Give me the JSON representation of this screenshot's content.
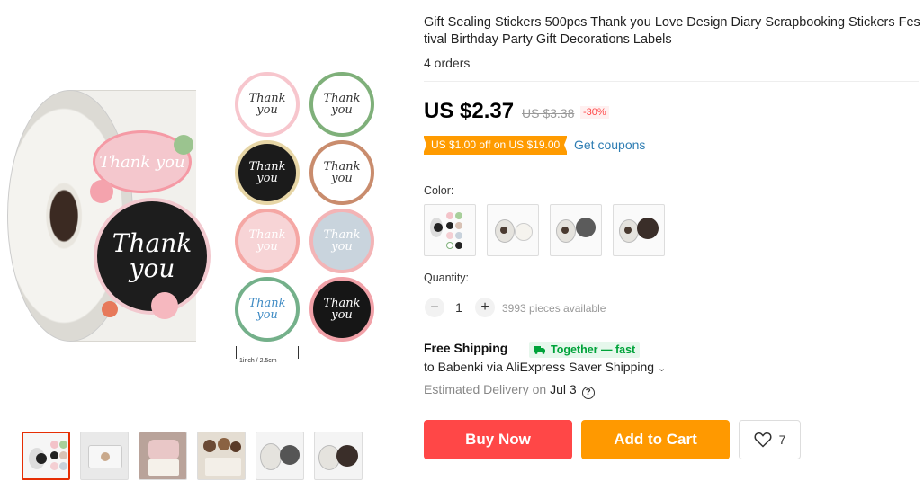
{
  "product": {
    "title": "Gift Sealing Stickers 500pcs Thank you Love Design Diary Scrapbooking Stickers Festival Birthday Party Gift Decorations Labels",
    "orders": "4 orders"
  },
  "main_image": {
    "big_sticker_text": "Thank you",
    "pink_sticker_text": "Thank you",
    "grid_texts": [
      "Thank you",
      "Thank you",
      "Thank you",
      "Thank you",
      "Thank you",
      "Thank you",
      "Thank you",
      "Thank you"
    ],
    "size_label": "1inch / 2.5cm"
  },
  "price": {
    "current": "US $2.37",
    "original": "US $3.38",
    "discount": "-30%"
  },
  "coupon": {
    "label": "US $1.00 off on US $19.00",
    "link": "Get coupons"
  },
  "color": {
    "label": "Color:"
  },
  "quantity": {
    "label": "Quantity:",
    "minus": "−",
    "plus": "+",
    "value": "1",
    "available": "3993 pieces available"
  },
  "shipping": {
    "free": "Free Shipping",
    "badge": "Together — fast",
    "to": "to Babenki via AliExpress Saver Shipping",
    "delivery_prefix": "Estimated Delivery on",
    "delivery_date": "Jul 3",
    "help": "?"
  },
  "actions": {
    "buy_now": "Buy Now",
    "add_to_cart": "Add to Cart",
    "wishlist_count": "7"
  },
  "colors": {
    "accent_red": "#ff4747",
    "accent_orange": "#ff9900",
    "link_blue": "#2e7db3",
    "green": "#00a33a"
  }
}
